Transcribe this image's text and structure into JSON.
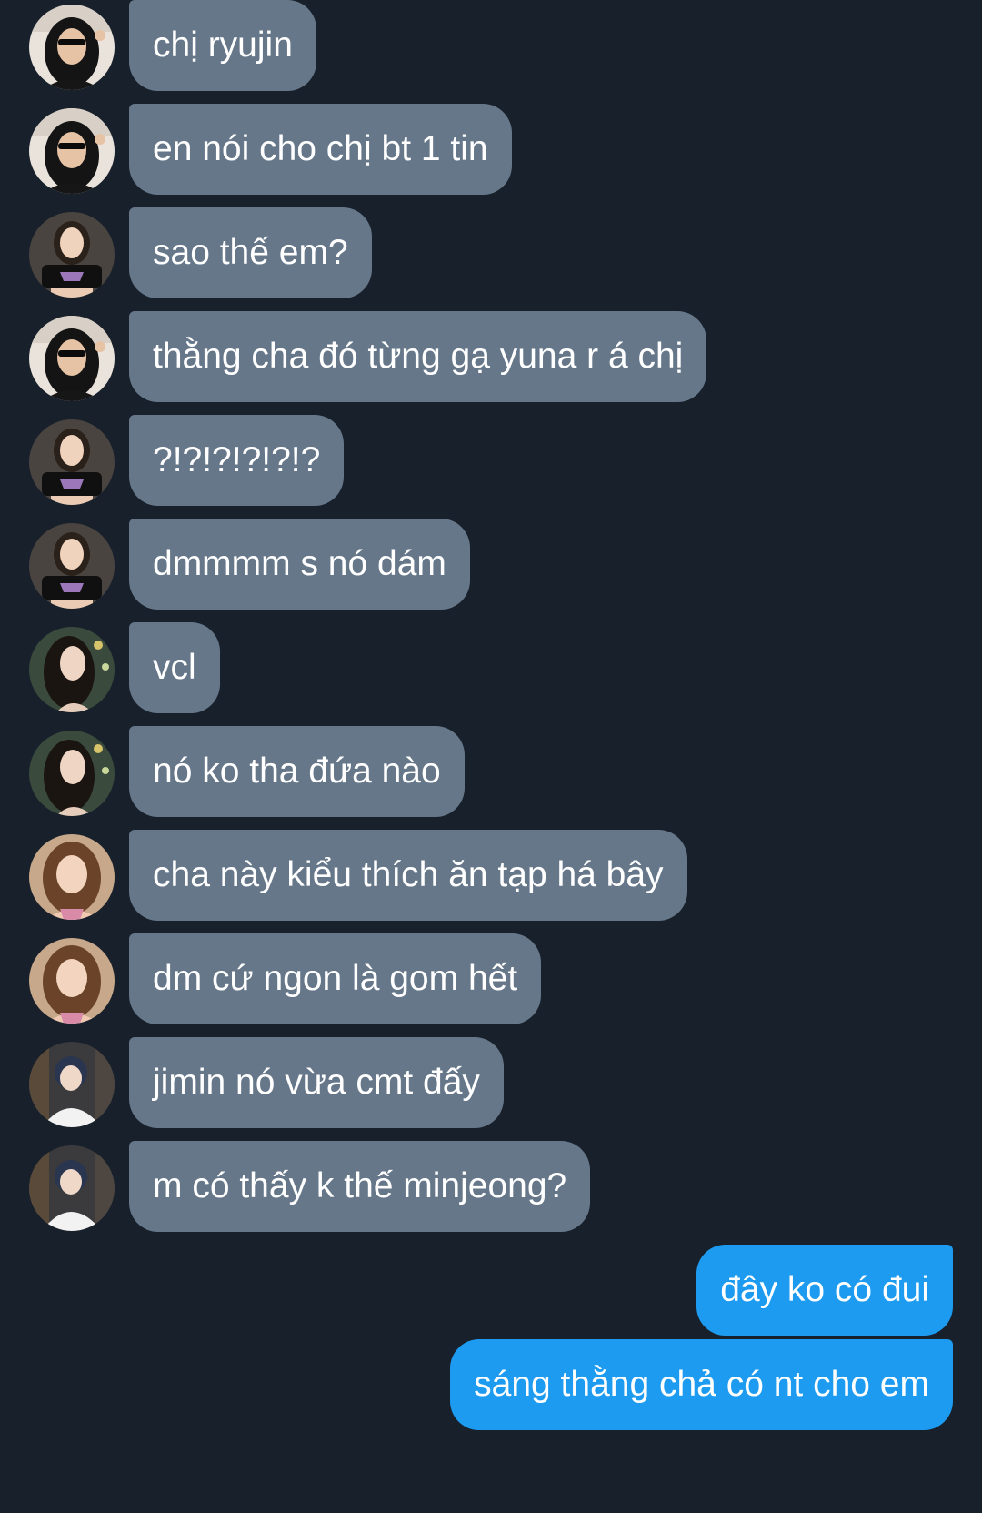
{
  "messages": [
    {
      "text": "chị ryujin",
      "direction": "in",
      "avatar": "avatar-sunglasses-woman"
    },
    {
      "text": "en nói cho chị bt 1 tin",
      "direction": "in",
      "avatar": "avatar-sunglasses-woman"
    },
    {
      "text": "sao thế em?",
      "direction": "in",
      "avatar": "avatar-black-top-woman"
    },
    {
      "text": "thằng cha đó từng gạ yuna r á chị",
      "direction": "in",
      "avatar": "avatar-sunglasses-woman"
    },
    {
      "text": "?!?!?!?!?!?",
      "direction": "in",
      "avatar": "avatar-black-top-woman"
    },
    {
      "text": "dmmmm s nó dám",
      "direction": "in",
      "avatar": "avatar-black-top-woman"
    },
    {
      "text": "vcl",
      "direction": "in",
      "avatar": "avatar-dark-hair-woman"
    },
    {
      "text": "nó ko tha đứa nào",
      "direction": "in",
      "avatar": "avatar-dark-hair-woman"
    },
    {
      "text": "cha này kiểu thích ăn tạp há bây",
      "direction": "in",
      "avatar": "avatar-brown-hair-woman"
    },
    {
      "text": "dm cứ ngon là gom hết",
      "direction": "in",
      "avatar": "avatar-brown-hair-woman"
    },
    {
      "text": "jimin nó vừa cmt đấy",
      "direction": "in",
      "avatar": "avatar-white-hoodie-person"
    },
    {
      "text": "m có thấy k thế minjeong?",
      "direction": "in",
      "avatar": "avatar-white-hoodie-person"
    },
    {
      "text": "đây ko có đui",
      "direction": "out"
    },
    {
      "text": "sáng thằng chả có nt cho em",
      "direction": "out"
    }
  ],
  "colors": {
    "background": "#17202b",
    "incoming_bubble": "#66778a",
    "outgoing_bubble": "#1d9bf0",
    "text": "#ffffff"
  }
}
